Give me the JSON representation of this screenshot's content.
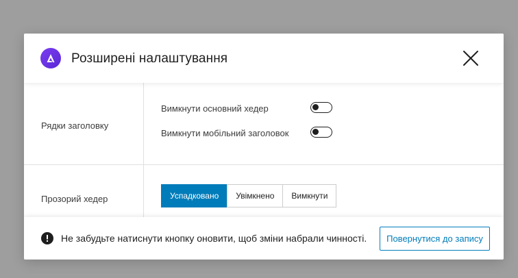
{
  "dialog": {
    "title": "Розширені налаштування",
    "logo_icon": "astra-logo-icon",
    "close_icon": "close-icon"
  },
  "sections": {
    "header_rows": {
      "label": "Рядки заголовку",
      "toggles": [
        {
          "label": "Вимкнути основний хедер",
          "checked": false
        },
        {
          "label": "Вимкнути мобільний заголовок",
          "checked": false
        }
      ]
    },
    "transparent_header": {
      "label": "Прозорий хедер",
      "options": [
        "Успадковано",
        "Увімкнено",
        "Вимкнути"
      ],
      "selected": "Успадковано"
    }
  },
  "footer": {
    "notice": "Не забудьте натиснути кнопку оновити, щоб зміни набрали чинності.",
    "notice_icon": "exclamation-circle-icon",
    "back_button": "Повернутися до запису"
  },
  "colors": {
    "accent": "#007cba",
    "logo": "#6a34e8",
    "overlay": "#9e9e9e"
  }
}
